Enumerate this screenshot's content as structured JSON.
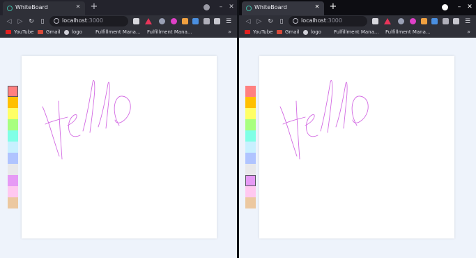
{
  "windows": [
    {
      "tab_title": "WhiteBoard",
      "url_host": "localhost",
      "url_port": ":3000",
      "bookmarks": [
        "YouTube",
        "Gmail",
        "logo",
        "Fulfillment Mana...",
        "Fulfillment Mana..."
      ],
      "selected_color": 0
    },
    {
      "tab_title": "WhiteBoard",
      "url_host": "localhost",
      "url_port": ":3000",
      "bookmarks": [
        "YouTube",
        "Gmail",
        "logo",
        "Fulfillment Mana...",
        "Fulfillment Mana..."
      ],
      "selected_color": 8
    }
  ],
  "palette_colors": [
    "#ff8080",
    "#ffc000",
    "#ffff66",
    "#a8ff80",
    "#80ffe6",
    "#c8f0ff",
    "#b0c4ff",
    "#e8e8ea",
    "#e69af5",
    "#ffc8f0",
    "#ecc8a0"
  ],
  "stroke_color": "#d36ae3",
  "labels": {
    "more_bookmarks": "»",
    "new_tab": "+",
    "close": "✕",
    "minimize": "–",
    "menu": "☰"
  }
}
